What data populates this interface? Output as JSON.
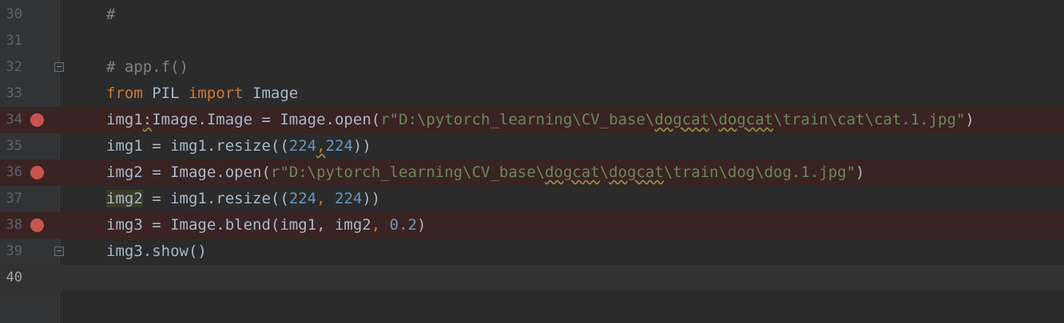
{
  "editor": {
    "lines": [
      {
        "num": "30",
        "tokens": [
          "#"
        ]
      },
      {
        "num": "31",
        "tokens": []
      },
      {
        "num": "32",
        "tokens": [
          "# app.f()"
        ]
      },
      {
        "num": "33",
        "tokens": [
          "from",
          " PIL ",
          "import",
          " Image"
        ]
      },
      {
        "num": "34",
        "tokens": [
          "img1",
          ":",
          "Image.Image = Image.open(",
          "r\"D:\\pytorch_learning\\CV_base\\",
          "dogcat",
          "\\",
          "dogcat",
          "\\train\\cat\\cat.1.jpg\"",
          ")"
        ]
      },
      {
        "num": "35",
        "tokens": [
          "img1 = img1.resize((",
          "224",
          ",",
          "224",
          "))"
        ]
      },
      {
        "num": "36",
        "tokens": [
          "img2 = Image.open(",
          "r\"D:\\pytorch_learning\\CV_base\\",
          "dogcat",
          "\\",
          "dogcat",
          "\\train\\dog\\dog.1.jpg\"",
          ")"
        ]
      },
      {
        "num": "37",
        "tokens": [
          "img2",
          " = img1.resize((",
          "224",
          ", ",
          "224",
          "))"
        ]
      },
      {
        "num": "38",
        "tokens": [
          "img3 = Image.blend(img1, img2",
          ", ",
          "0.2",
          ")"
        ]
      },
      {
        "num": "39",
        "tokens": [
          "img3.show()"
        ]
      },
      {
        "num": "40",
        "tokens": []
      }
    ]
  },
  "colors": {
    "background": "#2b2b2b",
    "gutter": "#313335",
    "breakpoint": "#c75450",
    "breakpoint_line": "#3a2323",
    "keyword": "#cc7832",
    "number": "#6897bb",
    "string": "#6a8759",
    "comment": "#808080",
    "text": "#a9b7c6"
  }
}
